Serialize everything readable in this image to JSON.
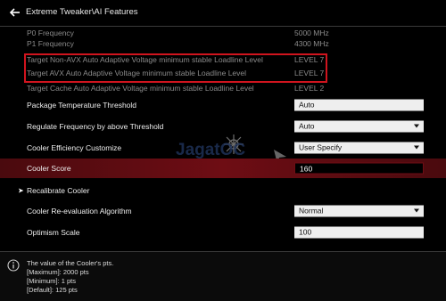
{
  "header": {
    "breadcrumb": "Extreme Tweaker\\AI Features"
  },
  "info_rows": [
    {
      "label": "P0 Frequency",
      "value": "5000 MHz"
    },
    {
      "label": "P1 Frequency",
      "value": "4300 MHz"
    },
    {
      "label": "Target Non-AVX Auto Adaptive Voltage minimum stable Loadline Level",
      "value": "LEVEL 7"
    },
    {
      "label": "Target AVX Auto Adaptive Voltage minimum stable Loadline Level",
      "value": "LEVEL 7"
    },
    {
      "label": "Target Cache Auto Adaptive Voltage minimum stable Loadline Level",
      "value": "LEVEL 2"
    }
  ],
  "settings": {
    "package_temp": {
      "label": "Package Temperature Threshold",
      "value": "Auto"
    },
    "regulate_freq": {
      "label": "Regulate Frequency by above Threshold",
      "value": "Auto"
    },
    "cooler_eff": {
      "label": "Cooler Efficiency Customize",
      "value": "User Specify"
    },
    "cooler_score": {
      "label": "Cooler Score",
      "value": "160"
    },
    "recalibrate": {
      "label": "Recalibrate Cooler",
      "arrow": "➤"
    },
    "reeval_algo": {
      "label": "Cooler Re-evaluation Algorithm",
      "value": "Normal"
    },
    "optimism": {
      "label": "Optimism Scale",
      "value": "100"
    }
  },
  "help": {
    "line1": "The value of the Cooler's pts.",
    "line2": "[Maximum]: 2000 pts",
    "line3": "[Minimum]: 1 pts",
    "line4": "[Default]: 125 pts"
  },
  "watermark": {
    "text": "JagatOC"
  },
  "colors": {
    "accent_red": "#d0141e",
    "selected_bg": "#6e0d14",
    "field_bg": "#eeeeee",
    "dim_text": "#8a8a8a"
  },
  "icons": {
    "back": "back-arrow-icon",
    "info": "info-icon",
    "submenu": "submenu-arrow-icon",
    "dropdown": "chevron-down-icon"
  }
}
